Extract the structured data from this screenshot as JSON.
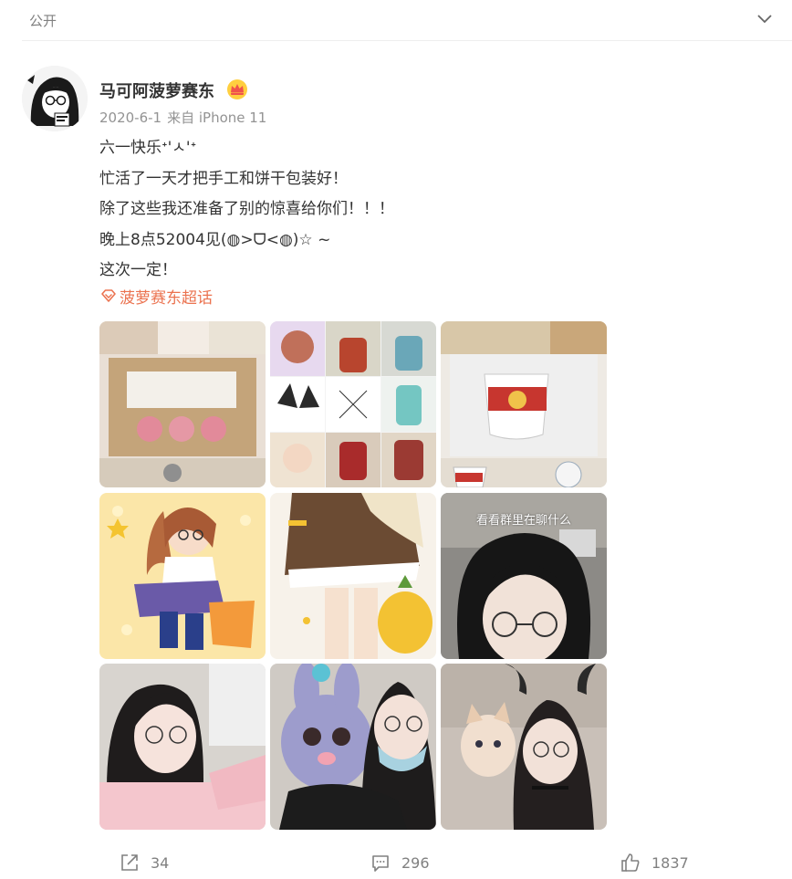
{
  "header": {
    "visibility_label": "公开",
    "collapse_icon": "chevron-down-icon"
  },
  "post": {
    "author": "马可阿菠萝赛东",
    "badge_icon": "crown-badge-icon",
    "date": "2020-6-1",
    "source": "来自 iPhone 11",
    "lines": [
      "六一快乐ᕀ'ㅅ'ᕀ",
      "忙活了一天才把手工和饼干包装好！",
      "除了这些我还准备了别的惊喜给你们！！！",
      "晚上8点52004见(◍>ᗜ<◍)☆ ~",
      "这次一定！"
    ],
    "topic": "菠萝赛东超话",
    "topic_icon": "supertopic-diamond-icon",
    "image_caption": "看看群里在聊什么"
  },
  "actions": {
    "repost_count": "34",
    "comment_count": "296",
    "like_count": "1837"
  },
  "colors": {
    "accent": "#eb7350",
    "muted": "#808080",
    "text": "#333333"
  }
}
